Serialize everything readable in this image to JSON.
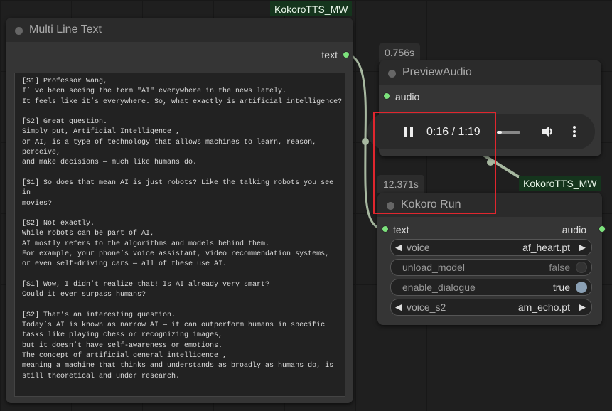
{
  "badges": {
    "top": "KokoroTTS_MW",
    "right": "KokoroTTS_MW"
  },
  "multiline_node": {
    "title": "Multi Line Text",
    "output_label": "text",
    "text": "[S1] Professor Wang,\nI’ ve been seeing the term \"AI\" everywhere in the news lately.\nIt feels like it’s everywhere. So, what exactly is artificial intelligence?\n\n[S2] Great question.\nSimply put, Artificial Intelligence ,\nor AI, is a type of technology that allows machines to learn, reason,\nperceive,\nand make decisions — much like humans do.\n\n[S1] So does that mean AI is just robots? Like the talking robots you see in\nmovies?\n\n[S2] Not exactly.\nWhile robots can be part of AI,\nAI mostly refers to the algorithms and models behind them.\nFor example, your phone’s voice assistant, video recommendation systems,\nor even self-driving cars — all of these use AI.\n\n[S1] Wow, I didn’t realize that! Is AI already very smart?\nCould it ever surpass humans?\n\n[S2] That’s an interesting question.\nToday’s AI is known as narrow AI — it can outperform humans in specific\ntasks like playing chess or recognizing images,\nbut it doesn’t have self-awareness or emotions.\nThe concept of artificial general intelligence ,\nmeaning a machine that thinks and understands as broadly as humans do, is\nstill theoretical and under research."
  },
  "preview_node": {
    "time_badge": "0.756s",
    "title": "PreviewAudio",
    "input_label": "audio",
    "player": {
      "time": "0:16 / 1:19",
      "progress": 0.2,
      "volume_level": 0.6
    }
  },
  "kokoro_node": {
    "time_badge": "12.371s",
    "title": "Kokoro Run",
    "input_label": "text",
    "output_label": "audio",
    "widgets": {
      "voice": {
        "name": "voice",
        "value": "af_heart.pt"
      },
      "unload_model": {
        "name": "unload_model",
        "value": "false"
      },
      "enable_dialogue": {
        "name": "enable_dialogue",
        "value": "true"
      },
      "voice_s2": {
        "name": "voice_s2",
        "value": "am_echo.pt"
      }
    }
  },
  "icons": {
    "play_pause": "pause-icon",
    "volume": "volume-icon",
    "more": "more-vertical-icon",
    "prev": "left-triangle-icon",
    "next": "right-triangle-icon"
  },
  "colors": {
    "socket_green": "#7ce27c",
    "badge_bg": "#15351d",
    "highlight_red": "#e0262e",
    "link": "#a7b8a0"
  }
}
